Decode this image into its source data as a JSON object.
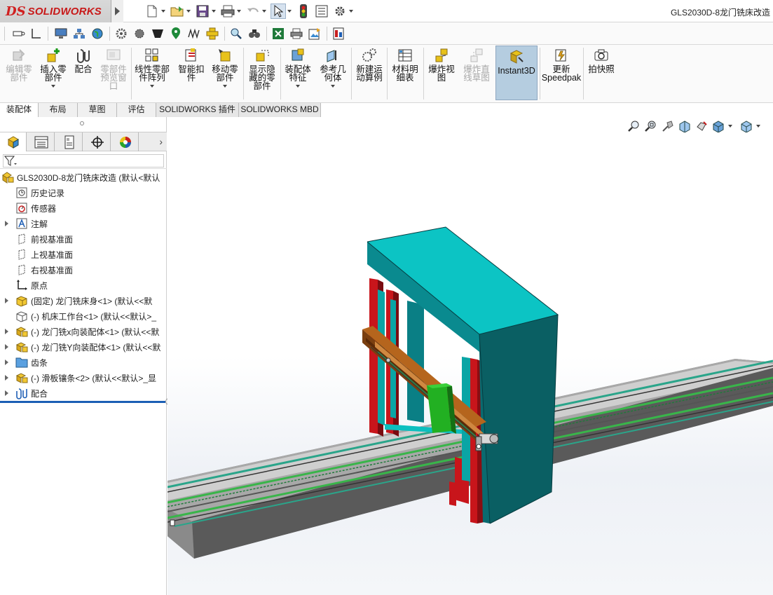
{
  "app": {
    "name": "SOLIDWORKS",
    "logo_mark": "DS"
  },
  "document_title": "GLS2030D-8龙门铣床改造",
  "quick_access": [
    {
      "icon": "new-document-icon"
    },
    {
      "icon": "open-icon"
    },
    {
      "icon": "save-icon"
    },
    {
      "icon": "print-icon"
    },
    {
      "icon": "undo-icon"
    },
    {
      "icon": "select-icon"
    },
    {
      "icon": "rebuild-icon"
    },
    {
      "icon": "file-properties-icon"
    },
    {
      "icon": "options-icon"
    }
  ],
  "command_manager": {
    "items": [
      {
        "label": "编辑零\n部件",
        "disabled": true,
        "icon": "edit-component-icon"
      },
      {
        "label": "插入零\n部件",
        "disabled": false,
        "icon": "insert-component-icon"
      },
      {
        "label": "配合",
        "disabled": false,
        "icon": "mate-icon"
      },
      {
        "label": "零部件\n预览窗\n口",
        "disabled": true,
        "icon": "component-preview-icon"
      },
      {
        "label": "线性零部\n件阵列",
        "disabled": false,
        "icon": "linear-pattern-icon"
      },
      {
        "label": "智能扣\n件",
        "disabled": false,
        "icon": "smart-fasteners-icon"
      },
      {
        "label": "移动零\n部件",
        "disabled": false,
        "icon": "move-component-icon"
      },
      {
        "label": "显示隐\n藏的零\n部件",
        "disabled": false,
        "icon": "show-hidden-icon"
      },
      {
        "label": "装配体\n特征",
        "disabled": false,
        "icon": "assembly-features-icon"
      },
      {
        "label": "参考几\n何体",
        "disabled": false,
        "icon": "reference-geometry-icon"
      },
      {
        "label": "新建运\n动算例",
        "disabled": false,
        "icon": "motion-study-icon"
      },
      {
        "label": "材料明\n细表",
        "disabled": false,
        "icon": "bom-icon"
      },
      {
        "label": "爆炸视\n图",
        "disabled": false,
        "icon": "exploded-view-icon"
      },
      {
        "label": "爆炸直\n线草图",
        "disabled": true,
        "icon": "explode-line-sketch-icon"
      },
      {
        "label": "Instant3D",
        "disabled": false,
        "active": true,
        "icon": "instant3d-icon"
      },
      {
        "label": "更新\nSpeedpak",
        "disabled": false,
        "icon": "speedpak-icon"
      },
      {
        "label": "拍快照",
        "disabled": false,
        "icon": "snapshot-icon"
      }
    ]
  },
  "tabs": [
    "装配体",
    "布局",
    "草图",
    "评估",
    "SOLIDWORKS 插件",
    "SOLIDWORKS MBD"
  ],
  "feature_tree": {
    "root": "GLS2030D-8龙门铣床改造 (默认<默认",
    "items": [
      {
        "label": "历史记录",
        "icon": "history-icon",
        "expandable": false
      },
      {
        "label": "传感器",
        "icon": "sensors-icon",
        "expandable": false
      },
      {
        "label": "注解",
        "icon": "annotations-icon",
        "expandable": true
      },
      {
        "label": "前视基准面",
        "icon": "plane-icon",
        "expandable": false
      },
      {
        "label": "上视基准面",
        "icon": "plane-icon",
        "expandable": false
      },
      {
        "label": "右视基准面",
        "icon": "plane-icon",
        "expandable": false
      },
      {
        "label": "原点",
        "icon": "origin-icon",
        "expandable": false
      },
      {
        "label": "(固定) 龙门铣床身<1> (默认<<默",
        "icon": "part-icon",
        "expandable": true
      },
      {
        "label": "(-) 机床工作台<1> (默认<<默认>_",
        "icon": "part-outline-icon",
        "expandable": false
      },
      {
        "label": "(-) 龙门铣x向装配体<1> (默认<<默",
        "icon": "subassembly-icon",
        "expandable": true
      },
      {
        "label": "(-) 龙门铣Y向装配体<1> (默认<<默",
        "icon": "subassembly-icon",
        "expandable": true
      },
      {
        "label": "齿条",
        "icon": "folder-icon",
        "expandable": true
      },
      {
        "label": "(-) 滑板镶条<2> (默认<<默认>_显",
        "icon": "subassembly-icon",
        "expandable": true
      },
      {
        "label": "配合",
        "icon": "mates-icon",
        "expandable": true
      }
    ]
  },
  "heads_up_toolbar": [
    {
      "icon": "zoom-to-fit-icon"
    },
    {
      "icon": "zoom-to-area-icon"
    },
    {
      "icon": "previous-view-icon"
    },
    {
      "icon": "section-view-icon"
    },
    {
      "icon": "view-orientation-icon"
    },
    {
      "icon": "display-style-icon"
    },
    {
      "icon": "hide-show-items-icon"
    }
  ],
  "colors": {
    "gantry_teal": "#0cbfbf",
    "gantry_dark": "#0a5f63",
    "frame_red": "#c8151b",
    "rail_gray": "#9a9a9a",
    "slide_orange": "#b5651d",
    "block_green": "#22b022"
  }
}
